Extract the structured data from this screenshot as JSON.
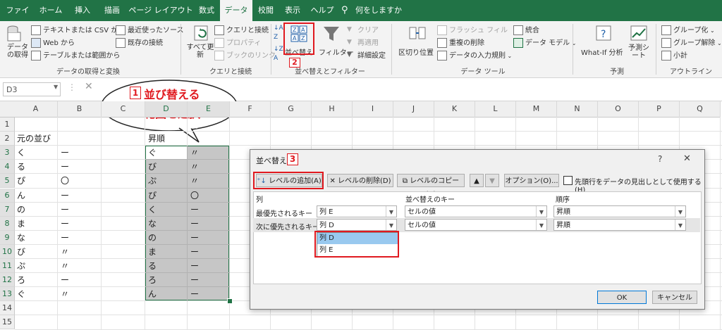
{
  "tabs": [
    "ファイル",
    "ホーム",
    "挿入",
    "描画",
    "ページ レイアウト",
    "数式",
    "データ",
    "校閲",
    "表示",
    "ヘルプ",
    "何をしますか"
  ],
  "ribbon": {
    "get_data": "データの取得",
    "text_csv": "テキストまたは CSV から",
    "web": "Web から",
    "table_range": "テーブルまたは範囲から",
    "recent_sources": "最近使ったソース",
    "existing_conn": "既存の接続",
    "group_get": "データの取得と変換",
    "refresh_all": "すべて更新",
    "queries_conn": "クエリと接続",
    "properties": "プロパティ",
    "edit_links": "ブックのリンク",
    "group_query": "クエリと接続",
    "sort": "並べ替え",
    "filter": "フィルター",
    "clear": "クリア",
    "reapply": "再適用",
    "advanced": "詳細設定",
    "group_sort": "並べ替えとフィルター",
    "text_to_columns": "区切り位置",
    "flash_fill": "フラッシュ フィル",
    "remove_dup": "重複の削除",
    "validation": "データの入力規則",
    "consolidate": "統合",
    "data_model": "データ モデル",
    "group_tools": "データ ツール",
    "whatif": "What-If 分析",
    "forecast": "予測シート",
    "group_forecast": "予測",
    "group_outline_btn": "グループ化",
    "ungroup": "グループ解除",
    "subtotal": "小計",
    "group_outline": "アウトライン"
  },
  "name_box": "D3",
  "callout": {
    "num": "1",
    "line1": "並び替える",
    "line2": "範囲を選択"
  },
  "badges": {
    "sort": "2",
    "dialog": "3"
  },
  "columns": [
    "A",
    "B",
    "C",
    "D",
    "E",
    "F",
    "G",
    "H",
    "I",
    "J",
    "K",
    "L",
    "M",
    "N",
    "O",
    "P",
    "Q"
  ],
  "rows": [
    "1",
    "2",
    "3",
    "4",
    "5",
    "6",
    "7",
    "8",
    "9",
    "10",
    "11",
    "12",
    "13",
    "14",
    "15"
  ],
  "cells": {
    "a2": "元の並び",
    "d2": "昇順",
    "colA": [
      "く",
      "る",
      "ぴ",
      "ん",
      "の",
      "ま",
      "な",
      "び",
      "ぷ",
      "ろ",
      "ぐ"
    ],
    "colB": [
      "ー",
      "ー",
      "〇",
      "ー",
      "ー",
      "ー",
      "ー",
      "〃",
      "〃",
      "ー",
      "〃"
    ],
    "colD": [
      "ぐ",
      "び",
      "ぷ",
      "ぴ",
      "く",
      "な",
      "の",
      "ま",
      "る",
      "ろ",
      "ん"
    ],
    "colE": [
      "〃",
      "〃",
      "〃",
      "〇",
      "ー",
      "ー",
      "ー",
      "ー",
      "ー",
      "ー",
      "ー"
    ]
  },
  "dialog": {
    "title": "並べ替え",
    "help": "?",
    "add_level": "レベルの追加(A)",
    "delete_level": "レベルの削除(D)",
    "copy_level": "レベルのコピー(C)",
    "options": "オプション(O)...",
    "header_checkbox": "先頭行をデータの見出しとして使用する(H)",
    "col_header": "列",
    "key_header": "並べ替えのキー",
    "order_header": "順序",
    "row1_label": "最優先されるキー",
    "row1_col": "列 E",
    "row1_key": "セルの値",
    "row1_order": "昇順",
    "row2_label": "次に優先されるキー",
    "row2_col": "列 D",
    "row2_key": "セルの値",
    "row2_order": "昇順",
    "dropdown_options": [
      "列 D",
      "列 E"
    ],
    "ok": "OK",
    "cancel": "キャンセル"
  }
}
